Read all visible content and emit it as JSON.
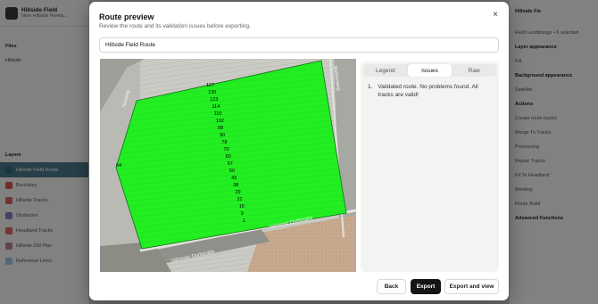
{
  "app": {
    "project_title": "Hillside Field",
    "project_subtitle": "New Hillside Fleeta...",
    "files_label": "Files",
    "active_row": "Hillside",
    "layers_label": "Layers",
    "layers": [
      {
        "label": "Hillside Field Route",
        "color": "#2e6b7d",
        "active": true
      },
      {
        "label": "Boundary",
        "color": "#d9534f",
        "active": false
      },
      {
        "label": "Hillside Tracks",
        "color": "#e06666",
        "active": false
      },
      {
        "label": "Obstacles",
        "color": "#8e7cc3",
        "active": false
      },
      {
        "label": "Headland Tracks",
        "color": "#e06666",
        "active": false
      },
      {
        "label": "Hillside Old Plan",
        "color": "#c27ba0",
        "active": false
      },
      {
        "label": "Reference Lines",
        "color": "#9fc5e8",
        "active": false
      }
    ],
    "right_title": "Hillside Fie",
    "right_rows": [
      {
        "label": "Field Landlinings • 6 selected",
        "heading": false
      },
      {
        "label": "Layer appearance",
        "heading": true
      },
      {
        "label": "Fill",
        "heading": false
      },
      {
        "label": "Background appearance",
        "heading": true
      },
      {
        "label": "Satellite",
        "heading": false
      },
      {
        "label": "Actions",
        "heading": true
      },
      {
        "label": "Create route tracks",
        "heading": false
      },
      {
        "label": "Merge To Tracks",
        "heading": false
      },
      {
        "label": "Processing",
        "heading": false
      },
      {
        "label": "Repair Tracks",
        "heading": false
      },
      {
        "label": "Fit To Headland",
        "heading": false
      },
      {
        "label": "Meeting",
        "heading": false
      },
      {
        "label": "Route Build",
        "heading": false
      },
      {
        "label": "Advanced Functions",
        "heading": true
      }
    ]
  },
  "modal": {
    "title": "Route preview",
    "description": "Review the route and its validation issues before exporting.",
    "close_glyph": "×",
    "route_name_value": "Hillside Field Route",
    "tabs": [
      {
        "label": "Legend",
        "active": false
      },
      {
        "label": "Issues",
        "active": true
      },
      {
        "label": "Raw",
        "active": false
      }
    ],
    "issues": [
      {
        "number": "1.",
        "text": "Validated route. No problems found. All tracks are valid!"
      }
    ],
    "buttons": {
      "back": "Back",
      "export": "Export",
      "export_and_view": "Export and view"
    }
  },
  "map": {
    "field_color": "#22ee22",
    "edge_label": "64",
    "track_labels": [
      "127",
      "130",
      "123",
      "114",
      "110",
      "102",
      "98",
      "90",
      "78",
      "70",
      "60",
      "57",
      "50",
      "43",
      "38",
      "29",
      "22",
      "15",
      "9",
      "1"
    ],
    "street_labels": [
      "Vahrener Dorfstraße",
      "Vahrener Dorfstraße",
      "Mühlenweg",
      "Heuweg"
    ]
  }
}
